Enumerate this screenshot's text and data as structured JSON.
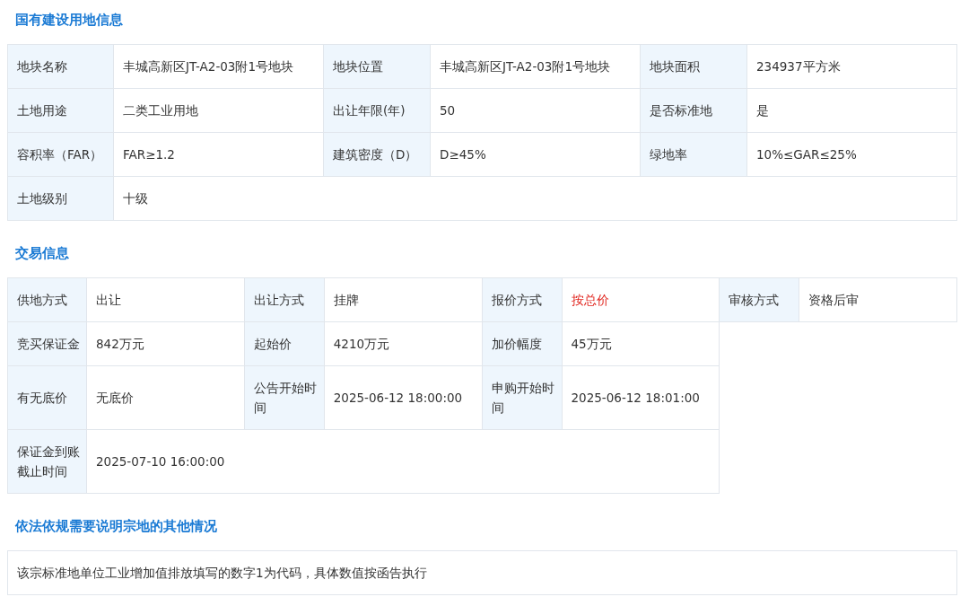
{
  "sections": [
    {
      "kind": "grid",
      "title": "国有建设用地信息",
      "rows": [
        [
          {
            "label": "地块名称",
            "value": "丰城高新区JT-A2-03附1号地块"
          },
          {
            "label": "地块位置",
            "value": "丰城高新区JT-A2-03附1号地块"
          },
          {
            "label": "地块面积",
            "value": "234937平方米"
          }
        ],
        [
          {
            "label": "土地用途",
            "value": "二类工业用地"
          },
          {
            "label": "出让年限(年)",
            "value": "50"
          },
          {
            "label": "是否标准地",
            "value": "是"
          }
        ],
        [
          {
            "label": "容积率（FAR）",
            "value": "FAR≥1.2"
          },
          {
            "label": "建筑密度（D）",
            "value": "D≥45%"
          },
          {
            "label": "绿地率",
            "value": "10%≤GAR≤25%"
          }
        ],
        [
          {
            "label": "土地级别",
            "value": "十级",
            "wide": true
          }
        ]
      ]
    },
    {
      "kind": "grid",
      "title": "交易信息",
      "rows": [
        [
          {
            "label": "供地方式",
            "value": "出让"
          },
          {
            "label": "出让方式",
            "value": "挂牌"
          },
          {
            "label": "报价方式",
            "value": "按总价",
            "highlight": true
          },
          {
            "label": "审核方式",
            "value": "资格后审"
          }
        ],
        [
          {
            "label": "竞买保证金",
            "value": "842万元"
          },
          {
            "label": "起始价",
            "value": "4210万元"
          },
          {
            "label": "加价幅度",
            "value": "45万元"
          }
        ],
        [
          {
            "label": "有无底价",
            "value": "无底价"
          },
          {
            "label": "公告开始时间",
            "value": "2025-06-12 18:00:00"
          },
          {
            "label": "申购开始时间",
            "value": "2025-06-12 18:01:00"
          }
        ],
        [
          {
            "label": "保证金到账截止时间",
            "value": "2025-07-10 16:00:00",
            "wide": true
          }
        ]
      ]
    },
    {
      "kind": "note",
      "title": "依法依规需要说明宗地的其他情况",
      "text": "该宗标准地单位工业增加值排放填写的数字1为代码，具体数值按函告执行"
    }
  ]
}
